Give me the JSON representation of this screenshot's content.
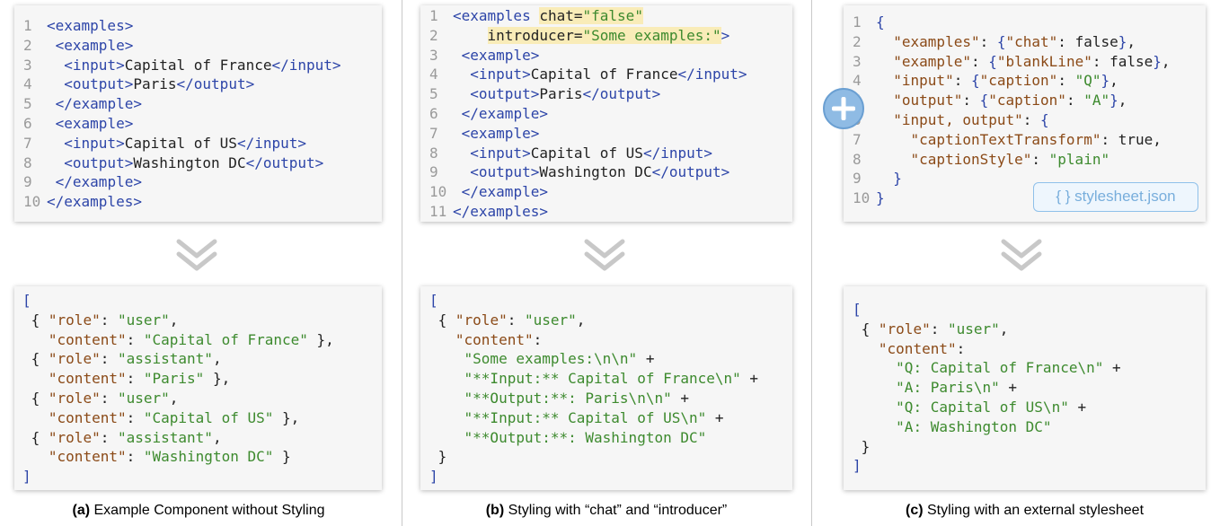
{
  "panel_a": {
    "caption_label": "(a)",
    "caption_text": " Example Component without Styling",
    "xml_lines": [
      {
        "n": "1",
        "t": "<examples>"
      },
      {
        "n": "2",
        "t": " <example>"
      },
      {
        "n": "3",
        "t": "  <input>Capital of France</input>"
      },
      {
        "n": "4",
        "t": "  <output>Paris</output>"
      },
      {
        "n": "5",
        "t": " </example>"
      },
      {
        "n": "6",
        "t": " <example>"
      },
      {
        "n": "7",
        "t": "  <input>Capital of US</input>"
      },
      {
        "n": "8",
        "t": "  <output>Washington DC</output>"
      },
      {
        "n": "9",
        "t": " </example>"
      },
      {
        "n": "10",
        "t": "</examples>"
      }
    ],
    "output_lines": [
      "[",
      " { \"role\": \"user\",",
      "   \"content\": \"Capital of France\" },",
      " { \"role\": \"assistant\",",
      "   \"content\": \"Paris\" },",
      " { \"role\": \"user\",",
      "   \"content\": \"Capital of US\" },",
      " { \"role\": \"assistant\",",
      "   \"content\": \"Washington DC\" }",
      "]"
    ]
  },
  "panel_b": {
    "caption_label": "(b)",
    "caption_text": " Styling with “chat” and “introducer”",
    "xml_lines": [
      {
        "n": "1",
        "t": "<examples chat=\"false\""
      },
      {
        "n": "2",
        "t": "    introducer=\"Some examples:\">"
      },
      {
        "n": "3",
        "t": " <example>"
      },
      {
        "n": "4",
        "t": "  <input>Capital of France</input>"
      },
      {
        "n": "5",
        "t": "  <output>Paris</output>"
      },
      {
        "n": "6",
        "t": " </example>"
      },
      {
        "n": "7",
        "t": " <example>"
      },
      {
        "n": "8",
        "t": "  <input>Capital of US</input>"
      },
      {
        "n": "9",
        "t": "  <output>Washington DC</output>"
      },
      {
        "n": "10",
        "t": " </example>"
      },
      {
        "n": "11",
        "t": "</examples>"
      }
    ],
    "output_lines": [
      "[",
      " { \"role\": \"user\",",
      "   \"content\":",
      "    \"Some examples:\\n\\n\" +",
      "    \"**Input:** Capital of France\\n\" +",
      "    \"**Output:**: Paris\\n\\n\" +",
      "    \"**Input:** Capital of US\\n\" +",
      "    \"**Output:**: Washington DC\"",
      " }",
      "]"
    ]
  },
  "panel_c": {
    "caption_label": "(c)",
    "caption_text": " Styling with an external stylesheet",
    "badge_label": "{ } stylesheet.json",
    "json_lines": [
      {
        "n": "1",
        "t": "{"
      },
      {
        "n": "2",
        "t": "  \"examples\": {\"chat\": false},"
      },
      {
        "n": "3",
        "t": "  \"example\": {\"blankLine\": false},"
      },
      {
        "n": "4",
        "t": "  \"input\": {\"caption\": \"Q\"},"
      },
      {
        "n": "5",
        "t": "  \"output\": {\"caption\": \"A\"},"
      },
      {
        "n": "6",
        "t": "  \"input, output\": {"
      },
      {
        "n": "7",
        "t": "    \"captionTextTransform\": true,"
      },
      {
        "n": "8",
        "t": "    \"captionStyle\": \"plain\""
      },
      {
        "n": "9",
        "t": "  }"
      },
      {
        "n": "10",
        "t": "}"
      }
    ],
    "output_lines": [
      "[",
      " { \"role\": \"user\",",
      "   \"content\":",
      "     \"Q: Capital of France\\n\" +",
      "     \"A: Paris\\n\" +",
      "     \"Q: Capital of US\\n\" +",
      "     \"A: Washington DC\"",
      " }",
      "]"
    ]
  },
  "colors": {
    "tag": "#2d45a8",
    "string": "#3d8a2e",
    "key": "#8b4a17",
    "highlight": "#f9ecb8",
    "line_number": "#9a9a9a",
    "panel_bg": "#f6f6f6",
    "chevron": "#c8c8c8",
    "plus_icon": "#7fb0de"
  }
}
